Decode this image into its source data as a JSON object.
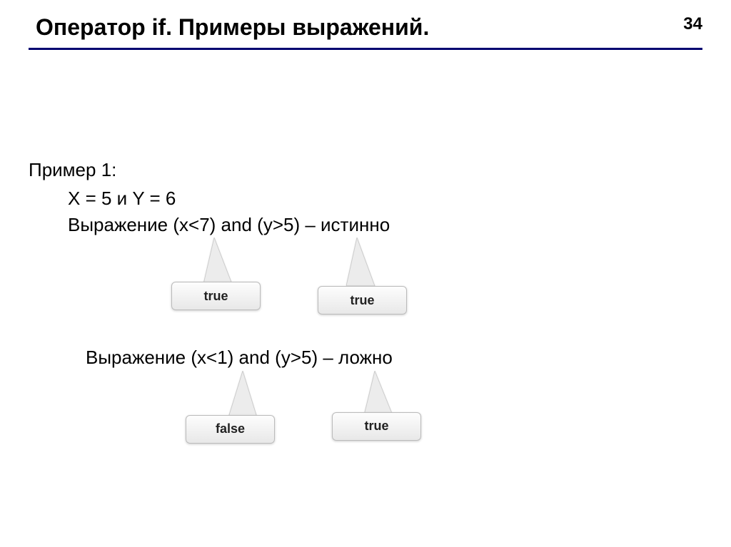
{
  "header": {
    "title": "Оператор if. Примеры выражений.",
    "page_number": "34"
  },
  "example": {
    "label": "Пример 1:",
    "vars": "X = 5 и Y = 6",
    "expr1": "Выражение (x<7) and (y>5) – истинно",
    "expr2": "Выражение (x<1) and (y>5) – ложно"
  },
  "callouts": {
    "expr1_left": "true",
    "expr1_right": "true",
    "expr2_left": "false",
    "expr2_right": "true"
  }
}
